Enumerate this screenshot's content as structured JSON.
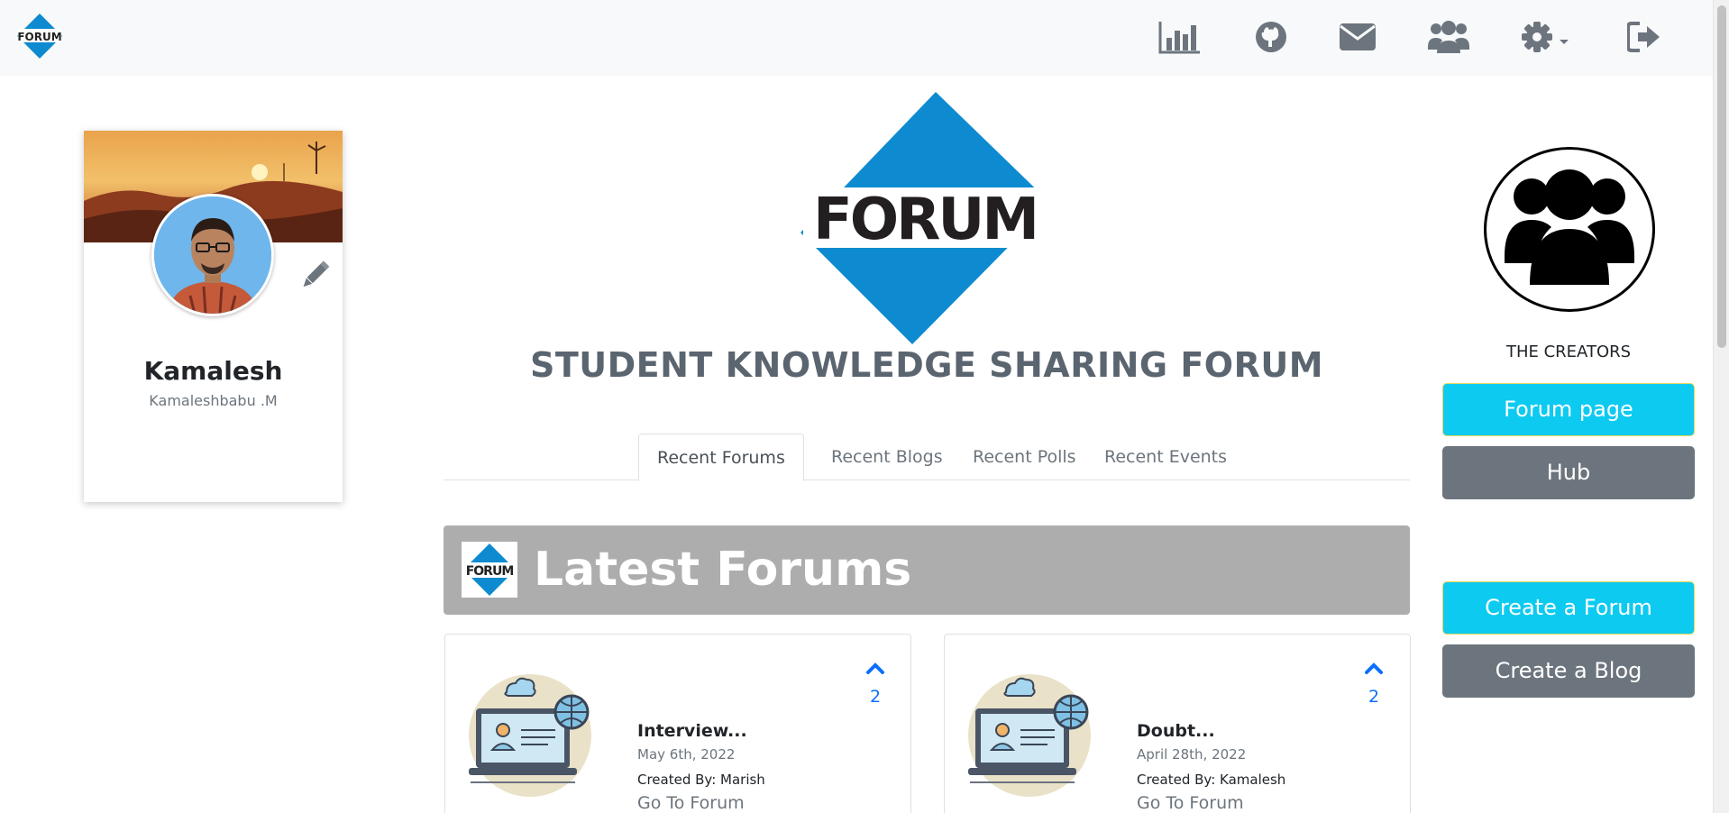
{
  "colors": {
    "navbar_bg": "#f8f9fa",
    "brand_blue": "#0e8bd0",
    "info_button": "#0dcaf0",
    "secondary_button": "#6c757d",
    "banner_bg": "#adadad",
    "link_blue": "#0d6efd"
  },
  "navbar": {
    "logo_text": "FORUM",
    "icons": [
      "chart-icon",
      "github-icon",
      "mail-icon",
      "users-icon",
      "gear-dropdown-icon",
      "logout-icon"
    ]
  },
  "profile": {
    "name": "Kamalesh",
    "username": "Kamaleshbabu .M"
  },
  "hero": {
    "logo_text": "FORUM",
    "title": "STUDENT KNOWLEDGE SHARING FORUM"
  },
  "tabs": [
    {
      "label": "Recent Forums",
      "active": true
    },
    {
      "label": "Recent Blogs",
      "active": false
    },
    {
      "label": "Recent Polls",
      "active": false
    },
    {
      "label": "Recent Events",
      "active": false
    }
  ],
  "latest": {
    "logo_text": "FORUM",
    "title": "Latest Forums"
  },
  "forums": [
    {
      "title": "Interview...",
      "date": "May 6th, 2022",
      "author": "Created By: Marish",
      "link": "Go To Forum",
      "votes": "2"
    },
    {
      "title": "Doubt...",
      "date": "April 28th, 2022",
      "author": "Created By: Kamalesh",
      "link": "Go To Forum",
      "votes": "2"
    }
  ],
  "sidebar": {
    "creators_label": "THE CREATORS",
    "forum_page_label": "Forum page",
    "hub_label": "Hub",
    "create_forum_label": "Create a Forum",
    "create_blog_label": "Create a Blog"
  }
}
